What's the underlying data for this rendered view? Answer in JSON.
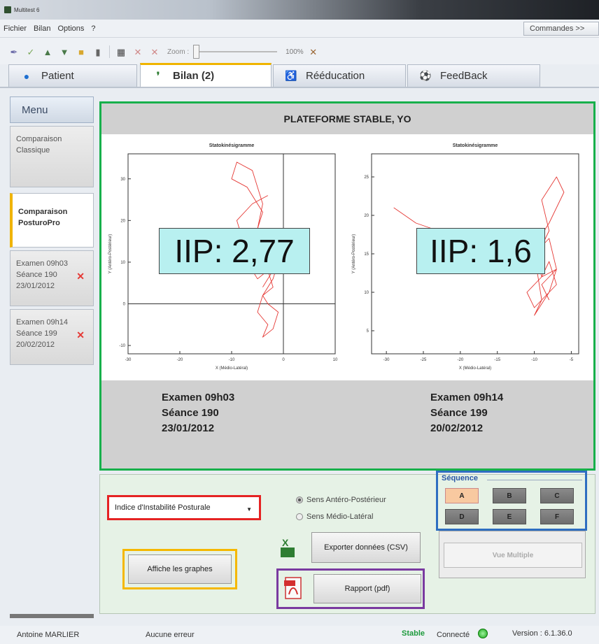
{
  "window": {
    "title": "Multitest 6"
  },
  "menubar": {
    "items": [
      "Fichier",
      "Bilan",
      "Options",
      "?"
    ],
    "commands_label": "Commandes >>"
  },
  "toolbar": {
    "zoom_label": "Zoom :",
    "zoom_percent": "100%",
    "zoom_value": 100
  },
  "tabs": [
    {
      "label": "Patient",
      "icon": "person-icon"
    },
    {
      "label": "Bilan (2)",
      "icon": "footprints-icon"
    },
    {
      "label": "Rééducation",
      "icon": "exercise-icon"
    },
    {
      "label": "FeedBack",
      "icon": "ball-icon"
    }
  ],
  "active_tab": 1,
  "sidebar": {
    "title": "Menu",
    "items": [
      {
        "line1": "Comparaison",
        "line2": "Classique"
      },
      {
        "line1": "Comparaison",
        "line2": "PosturoPro"
      },
      {
        "line1": "Examen 09h03",
        "line2": "Séance 190",
        "line3": "23/01/2012"
      },
      {
        "line1": "Examen 09h14",
        "line2": "Séance 199",
        "line3": "20/02/2012"
      }
    ]
  },
  "panel": {
    "title": "PLATEFORME STABLE, YO",
    "left": {
      "exam": "Examen 09h03",
      "session": "Séance 190",
      "date": "23/01/2012",
      "iip": "IIP: 2,77"
    },
    "right": {
      "exam": "Examen 09h14",
      "session": "Séance 199",
      "date": "20/02/2012",
      "iip": "IIP: 1,6"
    }
  },
  "chart_data": [
    {
      "type": "line",
      "title": "Statokinésigramme",
      "xlabel": "X (Médio-Latéral)",
      "ylabel": "Y (Antéro-Postérieur)",
      "xticks": [
        "-30",
        "-20",
        "-10",
        "0",
        "10"
      ],
      "yticks": [
        "-10",
        "0",
        "10",
        "20",
        "30"
      ],
      "xlim": [
        -30,
        10
      ],
      "ylim": [
        -12,
        36
      ],
      "series": [
        {
          "x": [
            -3,
            -6,
            -9,
            -8,
            -5,
            -4,
            -7,
            -10,
            -9,
            -6,
            -4,
            -5,
            -8,
            -6,
            -3,
            -2,
            -4,
            -6,
            -5,
            -3,
            -2,
            -4,
            -3,
            -1,
            -2,
            -4,
            -3,
            -5,
            -4,
            -2,
            -1,
            -3,
            -2,
            -4
          ],
          "y": [
            26,
            24,
            20,
            16,
            18,
            22,
            28,
            30,
            34,
            32,
            24,
            18,
            14,
            12,
            16,
            12,
            10,
            8,
            6,
            8,
            4,
            2,
            0,
            -2,
            -6,
            -8,
            -5,
            -2,
            2,
            6,
            10,
            12,
            8,
            4
          ]
        }
      ]
    },
    {
      "type": "line",
      "title": "Statokinésigramme",
      "xlabel": "X (Médio-Latéral)",
      "ylabel": "Y (Antéro-Postérieur)",
      "xticks": [
        "-30",
        "-25",
        "-20",
        "-15",
        "-10",
        "-5"
      ],
      "yticks": [
        "5",
        "10",
        "15",
        "20",
        "25"
      ],
      "xlim": [
        -32,
        -4
      ],
      "ylim": [
        2,
        28
      ],
      "series": [
        {
          "x": [
            -29,
            -26,
            -23,
            -20,
            -16,
            -13,
            -10,
            -9,
            -8,
            -9,
            -7,
            -6,
            -8,
            -10,
            -9,
            -8,
            -7,
            -9,
            -10,
            -8,
            -7,
            -9,
            -11,
            -10,
            -9,
            -10,
            -8,
            -7,
            -9,
            -8
          ],
          "y": [
            21,
            19,
            18,
            17,
            17,
            15,
            14,
            16,
            18,
            22,
            25,
            23,
            19,
            16,
            12,
            14,
            11,
            9,
            7,
            10,
            13,
            12,
            10,
            8,
            9,
            15,
            17,
            13,
            11,
            9
          ]
        }
      ]
    }
  ],
  "controls": {
    "indicator_select": "Indice d'Instabilité Posturale",
    "radio_ap": "Sens Antéro-Postérieur",
    "radio_ml": "Sens Médio-Latéral",
    "radio_selected": "ap",
    "export_label": "Exporter données (CSV)",
    "graphs_label": "Affiche les graphes",
    "report_label": "Rapport (pdf)"
  },
  "sequence": {
    "title": "Séquence",
    "buttons": [
      "A",
      "B",
      "C",
      "D",
      "E",
      "F"
    ],
    "selected": "A",
    "vue_multiple": "Vue Multiple"
  },
  "status": {
    "user": "Antoine MARLIER",
    "error": "Aucune erreur",
    "stable": "Stable",
    "connected": "Connecté",
    "version": "Version : 6.1.36.0"
  },
  "colors": {
    "panel_border": "#17b04b",
    "dropdown_border": "#e52323",
    "graphs_border": "#f5b800",
    "report_border": "#7a3aa0",
    "sequence_border": "#2e6ec1",
    "trace": "#e53935"
  }
}
